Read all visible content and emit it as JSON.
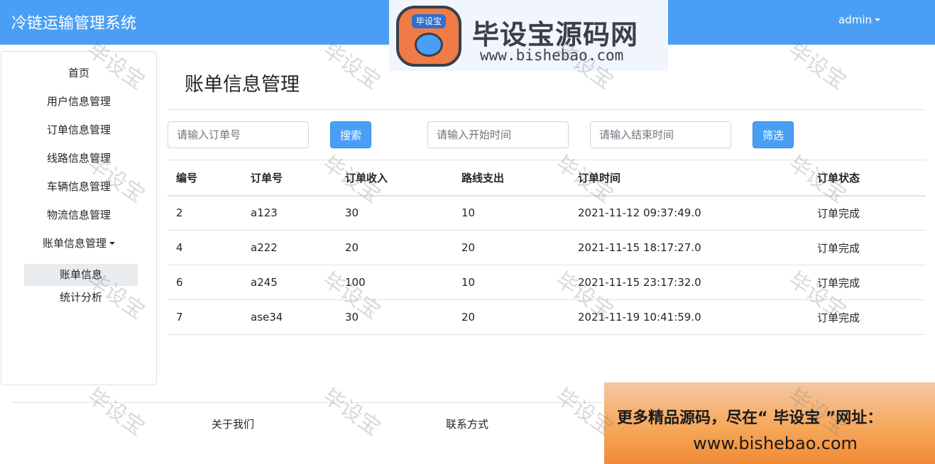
{
  "navbar": {
    "brand": "冷链运输管理系统",
    "user": "admin"
  },
  "logo_banner": {
    "badge_text": "毕设宝",
    "title": "毕设宝源码网",
    "url": "www.bishebao.com"
  },
  "sidebar": {
    "items": [
      "首页",
      "用户信息管理",
      "订单信息管理",
      "线路信息管理",
      "车辆信息管理",
      "物流信息管理",
      "账单信息管理"
    ],
    "sub_items": [
      "账单信息",
      "统计分析"
    ]
  },
  "page": {
    "title": "账单信息管理"
  },
  "filters": {
    "order_placeholder": "请输入订单号",
    "search_label": "搜索",
    "start_placeholder": "请输入开始时间",
    "end_placeholder": "请输入结束时间",
    "filter_label": "筛选"
  },
  "table": {
    "headers": [
      "编号",
      "订单号",
      "订单收入",
      "路线支出",
      "订单时间",
      "订单状态"
    ],
    "rows": [
      [
        "2",
        "a123",
        "30",
        "10",
        "2021-11-12 09:37:49.0",
        "订单完成"
      ],
      [
        "4",
        "a222",
        "20",
        "20",
        "2021-11-15 18:17:27.0",
        "订单完成"
      ],
      [
        "6",
        "a245",
        "100",
        "10",
        "2021-11-15 23:17:32.0",
        "订单完成"
      ],
      [
        "7",
        "ase34",
        "30",
        "20",
        "2021-11-19 10:41:59.0",
        "订单完成"
      ]
    ]
  },
  "footer": {
    "about": "关于我们",
    "contact": "联系方式"
  },
  "promo": {
    "line1": "更多精品源码，尽在“ 毕设宝 ”网址：",
    "line2": "www.bishebao.com"
  },
  "watermark_text": "毕设宝",
  "colors": {
    "primary": "#4a9ff5",
    "active_bg": "#e9ecef",
    "border": "#dee2e6"
  }
}
